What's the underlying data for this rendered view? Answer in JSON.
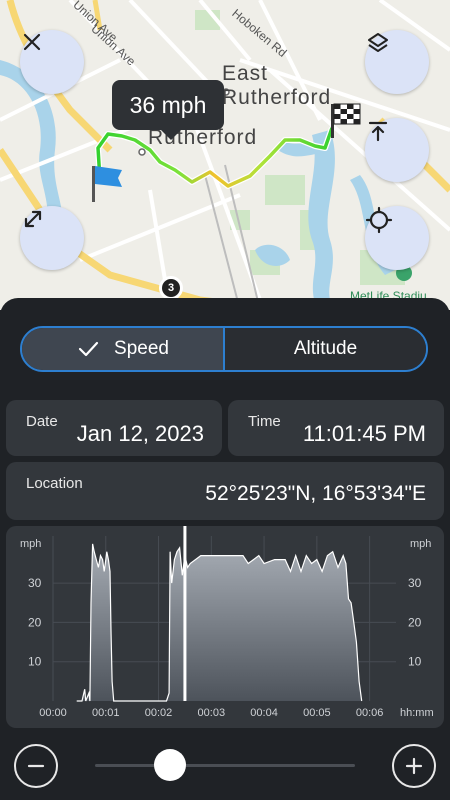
{
  "map": {
    "labels": {
      "union_ave_1": "Union Ave",
      "union_ave_2": "Union Ave",
      "hoboken_rd": "Hoboken Rd",
      "east_rutherford_1": "East",
      "east_rutherford_2": "Rutherford",
      "rutherford": "Rutherford",
      "metlife": "MetLife Stadiu"
    },
    "speed_tooltip": "36 mph",
    "marker_badge": "3"
  },
  "controls": {
    "close_icon": "close-icon",
    "layers_icon": "layers-icon",
    "expand_icon": "expand-icon",
    "top_icon": "align-top-icon",
    "locate_icon": "crosshair-icon"
  },
  "toggle": {
    "speed": "Speed",
    "altitude": "Altitude",
    "selected": "Speed"
  },
  "info": {
    "date_label": "Date",
    "date_value": "Jan 12, 2023",
    "time_label": "Time",
    "time_value": "11:01:45 PM",
    "location_label": "Location",
    "location_value": "52°25'23\"N, 16°53'34\"E"
  },
  "chart_data": {
    "type": "area",
    "ylabel_left": "mph",
    "ylabel_right": "mph",
    "xlabel": "hh:mm",
    "y_ticks": [
      "10",
      "20",
      "30"
    ],
    "x_ticks": [
      "00:00",
      "00:01",
      "00:02",
      "00:03",
      "00:04",
      "00:05",
      "00:06"
    ],
    "ylim": [
      0,
      42
    ],
    "xlim_minutes": [
      0,
      6.5
    ],
    "cursor_minutes": 2.5,
    "x": [
      0.45,
      0.55,
      0.6,
      0.62,
      0.68,
      0.7,
      0.72,
      0.75,
      0.78,
      0.82,
      0.86,
      0.9,
      0.94,
      0.97,
      1.0,
      1.02,
      1.05,
      1.08,
      1.1,
      1.12,
      1.15,
      1.2,
      1.4,
      1.6,
      1.8,
      2.0,
      2.15,
      2.2,
      2.22,
      2.25,
      2.3,
      2.35,
      2.4,
      2.45,
      2.5,
      2.55,
      2.6,
      2.8,
      3.0,
      3.3,
      3.6,
      3.7,
      3.8,
      3.9,
      4.0,
      4.2,
      4.4,
      4.5,
      4.6,
      4.7,
      4.8,
      4.9,
      5.0,
      5.1,
      5.2,
      5.3,
      5.4,
      5.5,
      5.55,
      5.6,
      5.65,
      5.7,
      5.75,
      5.8,
      5.85
    ],
    "y": [
      0,
      0,
      3,
      0,
      2,
      0,
      25,
      40,
      38,
      36,
      34,
      37,
      36,
      33,
      36,
      38,
      36,
      33,
      18,
      5,
      0,
      0,
      0,
      0,
      0,
      0,
      0,
      2,
      38,
      30,
      36,
      38,
      39,
      32,
      37,
      34,
      35,
      37,
      37,
      37,
      37,
      35,
      36,
      37,
      35,
      36,
      36,
      33,
      37,
      33,
      37,
      35,
      36,
      33,
      37,
      38,
      34,
      37,
      35,
      26,
      25,
      20,
      15,
      5,
      0
    ]
  },
  "zoom": {
    "minus": "−",
    "plus": "+",
    "level": 0.29
  }
}
